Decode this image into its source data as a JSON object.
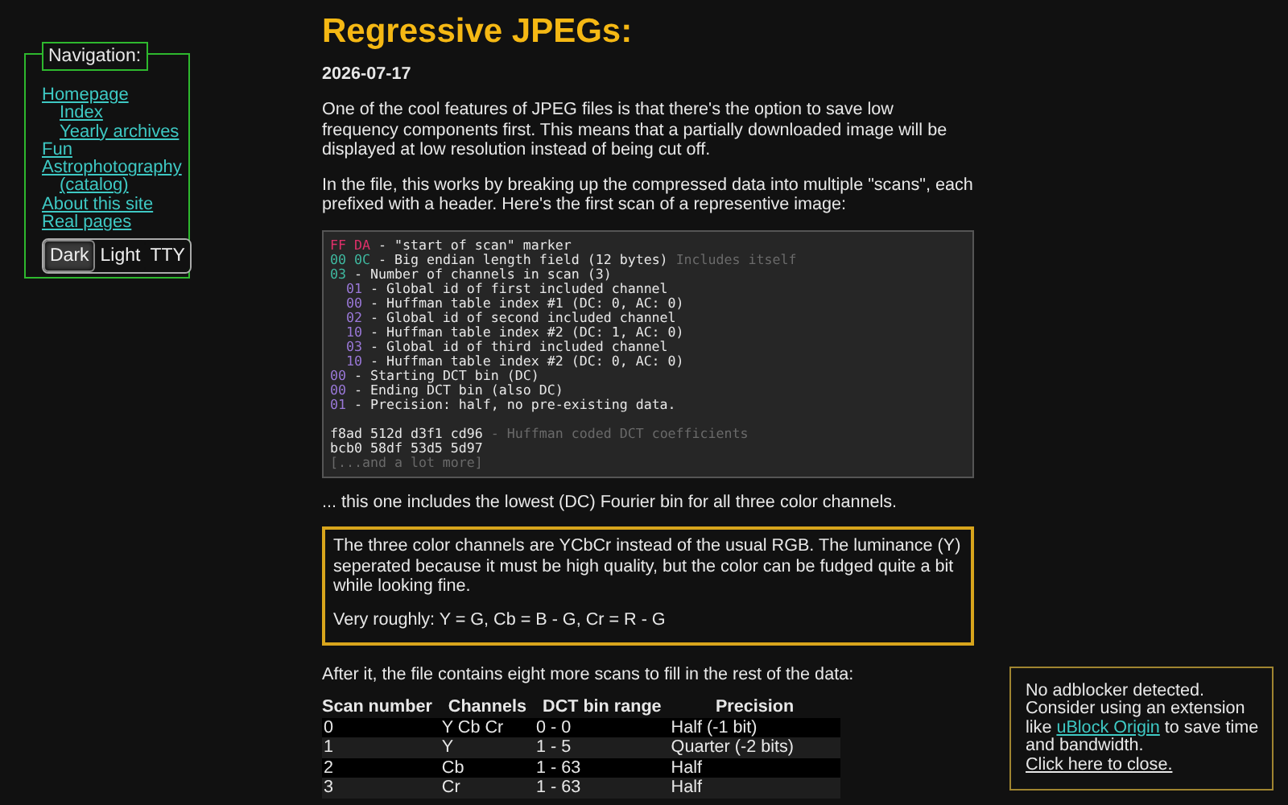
{
  "navigation": {
    "title": "Navigation:",
    "links": [
      {
        "label": "Homepage",
        "children": [
          {
            "label": "Index"
          },
          {
            "label": "Yearly archives"
          }
        ]
      },
      {
        "label": "Fun"
      },
      {
        "label": "Astrophotography",
        "children": [
          {
            "label": "(catalog)"
          }
        ]
      },
      {
        "label": "About this site"
      },
      {
        "label": "Real pages"
      }
    ],
    "themes": [
      {
        "label": "Dark",
        "selected": true
      },
      {
        "label": "Light",
        "selected": false
      },
      {
        "label": "TTY",
        "selected": false
      }
    ]
  },
  "article": {
    "title": "Regressive JPEGs:",
    "date": "2026-07-17",
    "intro": [
      "One of the cool features of JPEG files is that there's the option to save low frequency components first. This means that a partially downloaded image will be displayed at low resolution instead of being cut off.",
      "In the file, this works by breaking up the compressed data into multiple \"scans\", each prefixed with a header. Here's the first scan of a representive image:"
    ],
    "code_lines": [
      [
        {
          "kind": "marker",
          "text": "FF DA"
        },
        {
          "kind": "text",
          "text": " - \"start of scan\" marker"
        }
      ],
      [
        {
          "kind": "field",
          "text": "00 0C"
        },
        {
          "kind": "text",
          "text": " - Big endian length field (12 bytes) "
        },
        {
          "kind": "comment",
          "text": "Includes itself"
        }
      ],
      [
        {
          "kind": "field",
          "text": "03"
        },
        {
          "kind": "text",
          "text": " - Number of channels in scan (3)"
        }
      ],
      [
        {
          "kind": "value",
          "text": "  01"
        },
        {
          "kind": "text",
          "text": " - Global id of first included channel"
        }
      ],
      [
        {
          "kind": "value",
          "text": "  00"
        },
        {
          "kind": "text",
          "text": " - Huffman table index #1 (DC: 0, AC: 0)"
        }
      ],
      [
        {
          "kind": "value",
          "text": "  02"
        },
        {
          "kind": "text",
          "text": " - Global id of second included channel"
        }
      ],
      [
        {
          "kind": "value",
          "text": "  10"
        },
        {
          "kind": "text",
          "text": " - Huffman table index #2 (DC: 1, AC: 0)"
        }
      ],
      [
        {
          "kind": "value",
          "text": "  03"
        },
        {
          "kind": "text",
          "text": " - Global id of third included channel"
        }
      ],
      [
        {
          "kind": "value",
          "text": "  10"
        },
        {
          "kind": "text",
          "text": " - Huffman table index #2 (DC: 0, AC: 0)"
        }
      ],
      [
        {
          "kind": "value",
          "text": "00"
        },
        {
          "kind": "text",
          "text": " - Starting DCT bin (DC)"
        }
      ],
      [
        {
          "kind": "value",
          "text": "00"
        },
        {
          "kind": "text",
          "text": " - Ending DCT bin (also DC)"
        }
      ],
      [
        {
          "kind": "value",
          "text": "01"
        },
        {
          "kind": "text",
          "text": " - Precision: half, no pre-existing data."
        }
      ],
      [
        {
          "kind": "gap"
        },
        {
          "kind": "text",
          "text": "f8ad 512d d3f1 cd96"
        },
        {
          "kind": "comment",
          "text": " - Huffman coded DCT coefficients"
        }
      ],
      [
        {
          "kind": "text",
          "text": "bcb0 58df 53d5 5d97"
        }
      ],
      [
        {
          "kind": "comment",
          "text": "[...and a lot more]"
        }
      ]
    ],
    "after_code": "... this one includes the lowest (DC) Fourier bin for all three color channels.",
    "note": [
      "The three color channels are YCbCr instead of the usual RGB. The luminance (Y) seperated because it must be high quality, but the color can be fudged quite a bit while looking fine.",
      "Very roughly: Y = G, Cb = B - G, Cr = R - G"
    ],
    "table_intro": "After it, the file contains eight more scans to fill in the rest of the data:",
    "table": {
      "columns": [
        "Scan number",
        "Channels",
        "DCT bin range",
        "Precision"
      ],
      "rows": [
        [
          "0",
          "Y Cb Cr",
          "0 - 0",
          "Half (-1 bit)"
        ],
        [
          "1",
          "Y",
          "1 - 5",
          "Quarter (-2 bits)"
        ],
        [
          "2",
          "Cb",
          "1 - 63",
          "Half"
        ],
        [
          "3",
          "Cr",
          "1 - 63",
          "Half"
        ]
      ]
    }
  },
  "adblock_notice": {
    "text_before": "No adblocker detected. Consider using an extension like",
    "link": "uBlock Origin",
    "text_after": "to save time and bandwidth.",
    "close_link": "Click here to close."
  }
}
